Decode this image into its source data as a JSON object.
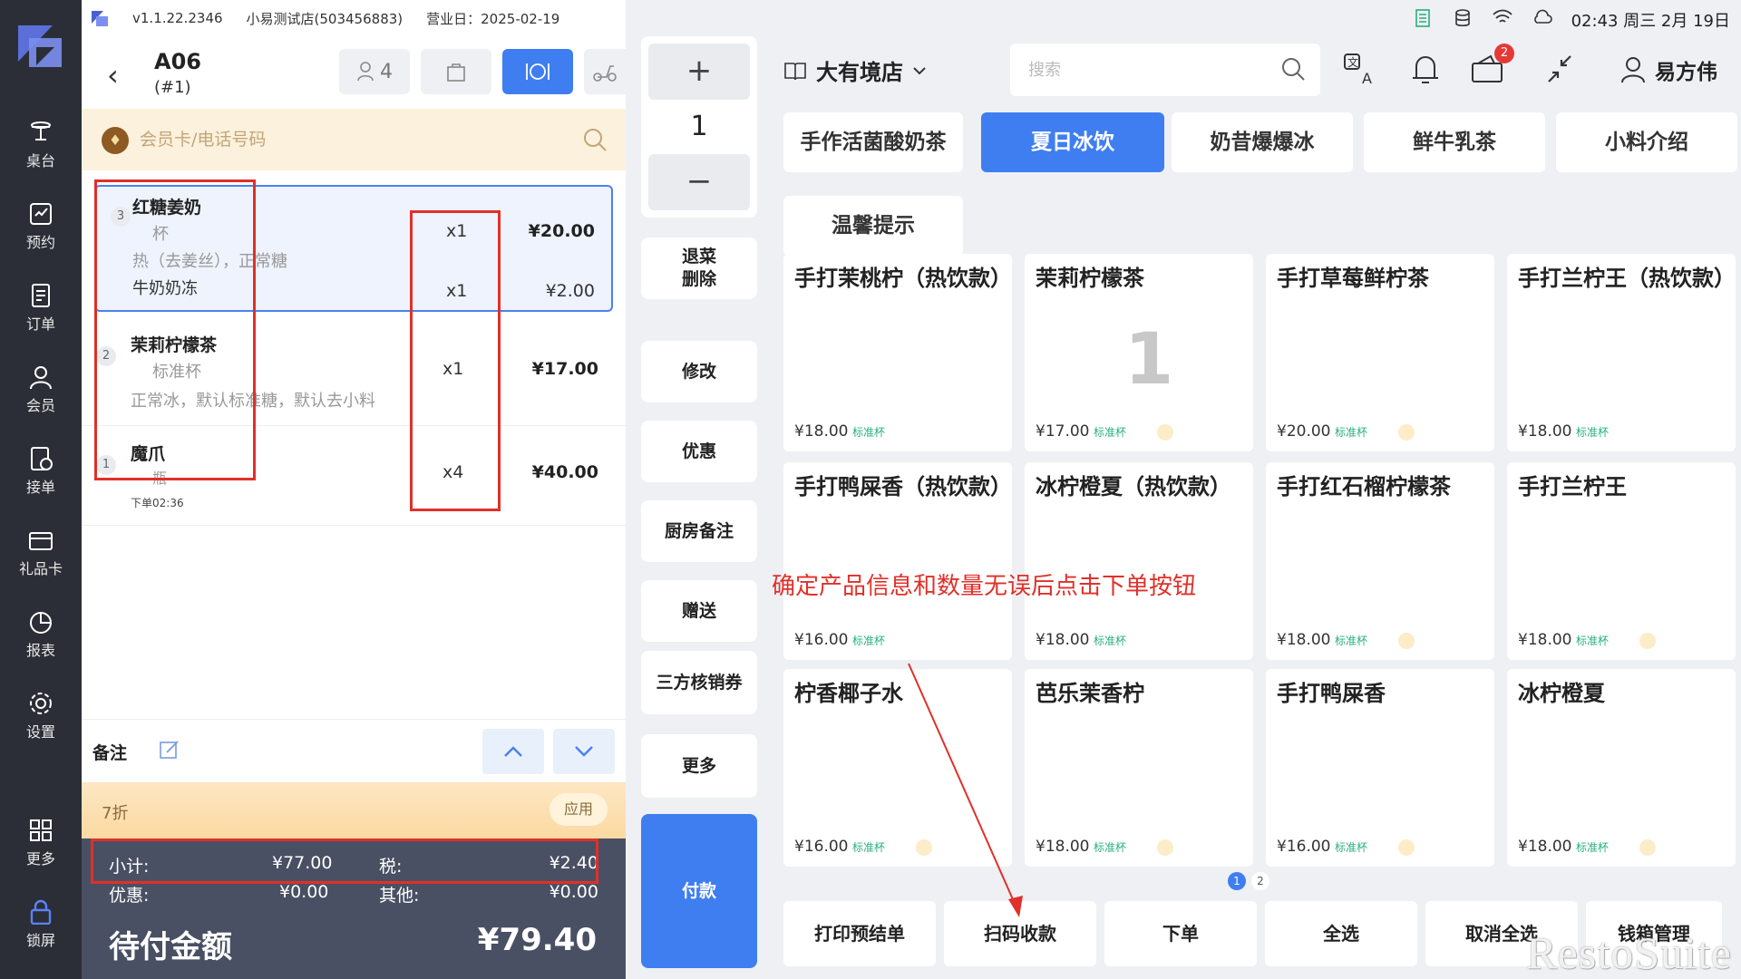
{
  "status": {
    "version": "v1.1.22.2346",
    "store_info": "小易测试店(503456883)",
    "business_date": "营业日：2025-02-19"
  },
  "nav": [
    {
      "label": "桌台",
      "icon": "table-icon"
    },
    {
      "label": "预约",
      "icon": "reservation-icon"
    },
    {
      "label": "订单",
      "icon": "order-icon"
    },
    {
      "label": "会员",
      "icon": "member-icon"
    },
    {
      "label": "接单",
      "icon": "accept-order-icon"
    },
    {
      "label": "礼品卡",
      "icon": "gift-card-icon"
    },
    {
      "label": "报表",
      "icon": "report-icon"
    },
    {
      "label": "设置",
      "icon": "settings-icon"
    },
    {
      "label": "更多",
      "icon": "more-grid-icon"
    },
    {
      "label": "锁屏",
      "icon": "lock-icon"
    }
  ],
  "table": {
    "name": "A06",
    "sub": "(#1)",
    "guests": "4"
  },
  "member": {
    "placeholder": "会员卡/电话号码"
  },
  "order_items": [
    {
      "index": "3",
      "name": "红糖姜奶",
      "spec": "杯",
      "options": "热（去姜丝），正常糖",
      "qty": "x1",
      "price": "¥20.00",
      "addon": "牛奶奶冻",
      "addon_qty": "x1",
      "addon_price": "¥2.00",
      "selected": true
    },
    {
      "index": "2",
      "name": "茉莉柠檬茶",
      "spec": "标准杯",
      "options": "正常冰，默认标准糖，默认去小料",
      "qty": "x1",
      "price": "¥17.00"
    },
    {
      "index": "1",
      "name": "魔爪",
      "spec": "瓶",
      "qty": "x4",
      "price": "¥40.00",
      "time": "下单02:36"
    }
  ],
  "remark": {
    "label": "备注"
  },
  "discount": {
    "label": "7折",
    "apply": "应用"
  },
  "totals": {
    "subtotal_label": "小计:",
    "subtotal": "¥77.00",
    "tax_label": "税:",
    "tax": "¥2.40",
    "discount_label": "优惠:",
    "discount": "¥0.00",
    "other_label": "其他:",
    "other": "¥0.00",
    "due_label": "待付金额",
    "due": "¥79.40"
  },
  "qty_control": {
    "plus": "+",
    "value": "1",
    "minus": "−"
  },
  "actions": [
    {
      "label": "退菜\n删除"
    },
    {
      "label": "修改"
    },
    {
      "label": "优惠"
    },
    {
      "label": "厨房备注"
    },
    {
      "label": "赠送"
    },
    {
      "label": "三方核销券"
    },
    {
      "label": "更多"
    },
    {
      "label": "付款"
    }
  ],
  "topbar": {
    "time": "02:43 周三 2月 19日"
  },
  "store_name": "大有境店",
  "search": {
    "placeholder": "搜索"
  },
  "notification_badge": "2",
  "user_name": "易方伟",
  "categories": [
    "手作活菌酸奶茶",
    "夏日冰饮",
    "奶昔爆爆冰",
    "鲜牛乳茶",
    "小料介绍",
    "温馨提示"
  ],
  "active_category": "夏日冰饮",
  "products": [
    {
      "name": "手打茉桃柠（热饮款）",
      "price": "¥18.00",
      "tag": "标准杯",
      "stack": false
    },
    {
      "name": "茉莉柠檬茶",
      "price": "¥17.00",
      "tag": "标准杯",
      "stack": true,
      "count": "1"
    },
    {
      "name": "手打草莓鲜柠茶",
      "price": "¥20.00",
      "tag": "标准杯",
      "stack": true
    },
    {
      "name": "手打兰柠王（热饮款）",
      "price": "¥18.00",
      "tag": "标准杯",
      "stack": false
    },
    {
      "name": "手打鸭屎香（热饮款）",
      "price": "¥16.00",
      "tag": "标准杯",
      "stack": false
    },
    {
      "name": "冰柠橙夏（热饮款）",
      "price": "¥18.00",
      "tag": "标准杯",
      "stack": false
    },
    {
      "name": "手打红石榴柠檬茶",
      "price": "¥18.00",
      "tag": "标准杯",
      "stack": true
    },
    {
      "name": "手打兰柠王",
      "price": "¥18.00",
      "tag": "标准杯",
      "stack": true
    },
    {
      "name": "柠香椰子水",
      "price": "¥16.00",
      "tag": "标准杯",
      "stack": true
    },
    {
      "name": "芭乐茉香柠",
      "price": "¥18.00",
      "tag": "标准杯",
      "stack": true
    },
    {
      "name": "手打鸭屎香",
      "price": "¥16.00",
      "tag": "标准杯",
      "stack": true
    },
    {
      "name": "冰柠橙夏",
      "price": "¥18.00",
      "tag": "标准杯",
      "stack": true
    }
  ],
  "pages": [
    "1",
    "2"
  ],
  "bottom_actions": [
    "打印预结单",
    "扫码收款",
    "下单",
    "全选",
    "取消全选",
    "钱箱管理"
  ],
  "annotation": "确定产品信息和数量无误后点击下单按钮",
  "watermark": "RestoSuite",
  "colors": {
    "accent": "#3f7ef0",
    "annotation": "#e0302a",
    "rail": "#2b2e36"
  }
}
